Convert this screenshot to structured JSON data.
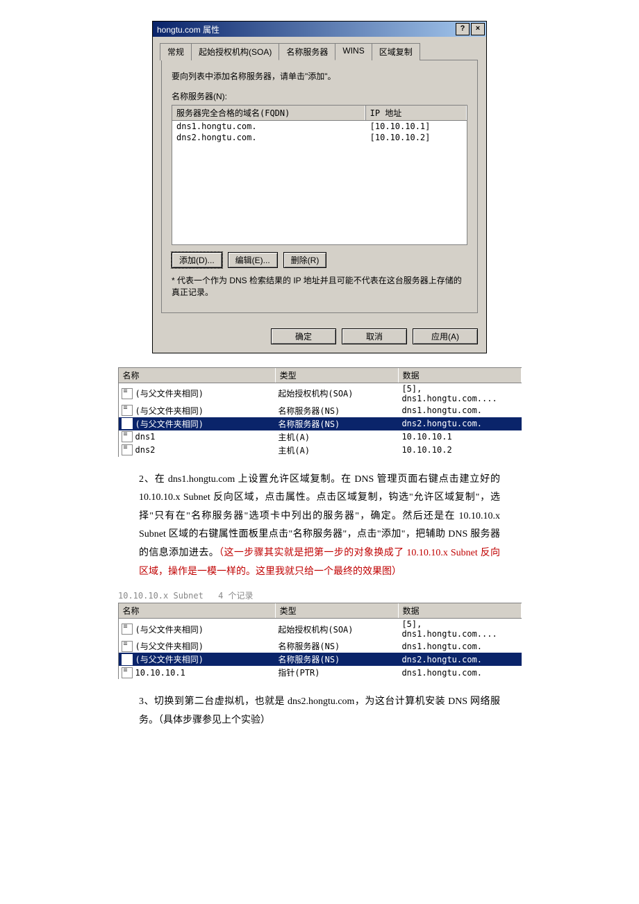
{
  "dialog": {
    "title": "hongtu.com 属性",
    "help_btn": "?",
    "close_btn": "×",
    "tabs": {
      "general": "常规",
      "soa": "起始授权机构(SOA)",
      "ns": "名称服务器",
      "wins": "WINS",
      "zone": "区域复制"
    },
    "instruction": "要向列表中添加名称服务器，请单击\"添加\"。",
    "ns_label": "名称服务器(N):",
    "cols": {
      "fqdn": "服务器完全合格的域名(FQDN)",
      "ip": "IP 地址"
    },
    "servers": [
      {
        "fqdn": "dns1.hongtu.com.",
        "ip": "[10.10.10.1]"
      },
      {
        "fqdn": "dns2.hongtu.com.",
        "ip": "[10.10.10.2]"
      }
    ],
    "buttons": {
      "add": "添加(D)...",
      "edit": "编辑(E)...",
      "remove": "删除(R)"
    },
    "note": "* 代表一个作为 DNS 检索结果的 IP 地址并且可能不代表在这台服务器上存储的真正记录。",
    "footer": {
      "ok": "确定",
      "cancel": "取消",
      "apply": "应用(A)"
    }
  },
  "records1": {
    "cols": {
      "name": "名称",
      "type": "类型",
      "data": "数据"
    },
    "rows": [
      {
        "name": "(与父文件夹相同)",
        "type": "起始授权机构(SOA)",
        "data": "[5], dns1.hongtu.com....",
        "sel": false
      },
      {
        "name": "(与父文件夹相同)",
        "type": "名称服务器(NS)",
        "data": "dns1.hongtu.com.",
        "sel": false
      },
      {
        "name": "(与父文件夹相同)",
        "type": "名称服务器(NS)",
        "data": "dns2.hongtu.com.",
        "sel": true
      },
      {
        "name": "dns1",
        "type": "主机(A)",
        "data": "10.10.10.1",
        "sel": false
      },
      {
        "name": "dns2",
        "type": "主机(A)",
        "data": "10.10.10.2",
        "sel": false
      }
    ]
  },
  "para1": {
    "lead": "2、在 dns1.hongtu.com 上设置允许区域复制。在 DNS 管理页面右键点击建立好的 10.10.10.x Subnet 反向区域，点击属性。点击区域复制，钩选\"允许区域复制\"，选择\"只有在\"名称服务器\"选项卡中列出的服务器\"，确定。然后还是在 10.10.10.x Subnet 区域的右键属性面板里点击\"名称服务器\"，点击\"添加\"，把辅助 DNS 服务器的信息添加进去。",
    "red": "（这一步骤其实就是把第一步的对象换成了 10.10.10.x Subnet 反向区域，操作是一模一样的。这里我就只给一个最终的效果图）"
  },
  "records2": {
    "title_zone": "10.10.10.x Subnet",
    "title_count": "4 个记录",
    "cols": {
      "name": "名称",
      "type": "类型",
      "data": "数据"
    },
    "rows": [
      {
        "name": "(与父文件夹相同)",
        "type": "起始授权机构(SOA)",
        "data": "[5], dns1.hongtu.com....",
        "sel": false
      },
      {
        "name": "(与父文件夹相同)",
        "type": "名称服务器(NS)",
        "data": "dns1.hongtu.com.",
        "sel": false
      },
      {
        "name": "(与父文件夹相同)",
        "type": "名称服务器(NS)",
        "data": "dns2.hongtu.com.",
        "sel": true
      },
      {
        "name": "10.10.10.1",
        "type": "指针(PTR)",
        "data": "dns1.hongtu.com.",
        "sel": false
      }
    ]
  },
  "para2": "3、切换到第二台虚拟机，也就是 dns2.hongtu.com，为这台计算机安装 DNS 网络服务。（具体步骤参见上个实验）"
}
